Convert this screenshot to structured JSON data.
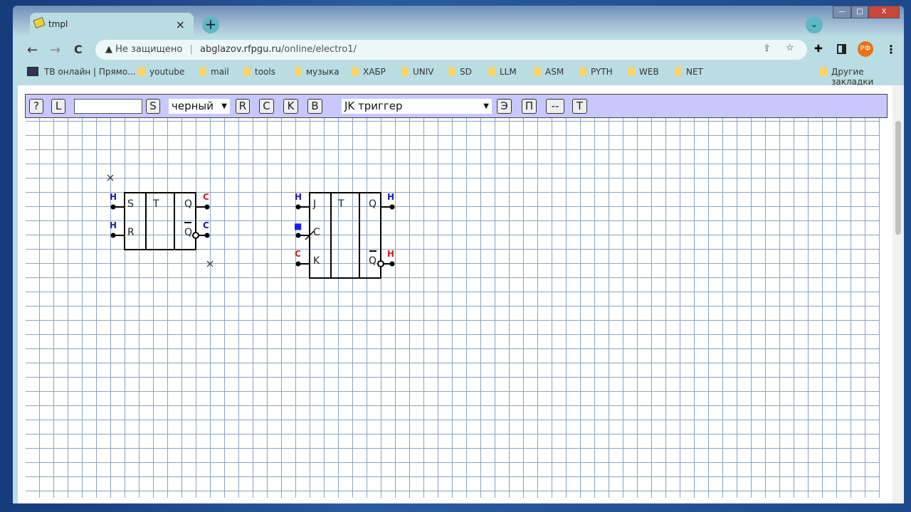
{
  "window": {
    "min": "—",
    "max": "□",
    "close": "X"
  },
  "tab": {
    "title": "tmpl",
    "close": "×",
    "new": "+",
    "list": "⌄"
  },
  "nav": {
    "back": "←",
    "forward": "→",
    "reload": "C",
    "security_label": "Не защищено",
    "url_host": "abglazov.rfpgu.ru",
    "url_path": "/online/electro1/",
    "profile": "РФ"
  },
  "bookmarks": [
    "ТВ онлайн | Прямо...",
    "youtube",
    "mail",
    "tools",
    "музыка",
    "ХАБР",
    "UNIV",
    "SD",
    "LLM",
    "ASM",
    "PYTH",
    "WEB",
    "NET"
  ],
  "other_bookmarks": "Другие закладки",
  "controls": {
    "help": "?",
    "load": "L",
    "name_value": "",
    "save": "S",
    "color": "черный",
    "r": "R",
    "c": "C",
    "k": "K",
    "b": "B",
    "element": "JK триггер",
    "e": "Э",
    "p": "П",
    "dash": "--",
    "t": "T"
  },
  "circuit": {
    "rs": {
      "in": [
        "S",
        "R"
      ],
      "title": "T",
      "out": [
        "Q",
        "Q"
      ],
      "in_states": [
        "Н",
        "Н"
      ],
      "out_states": [
        "С",
        "С"
      ]
    },
    "jk": {
      "in": [
        "J",
        "C",
        "K"
      ],
      "title": "T",
      "out": [
        "Q",
        "Q"
      ],
      "in_states": [
        "Н",
        "■",
        "С"
      ],
      "out_states": [
        "Н",
        "Н"
      ]
    },
    "colors": {
      "blue": "#1a1aa8",
      "red": "#d01e2a"
    }
  }
}
